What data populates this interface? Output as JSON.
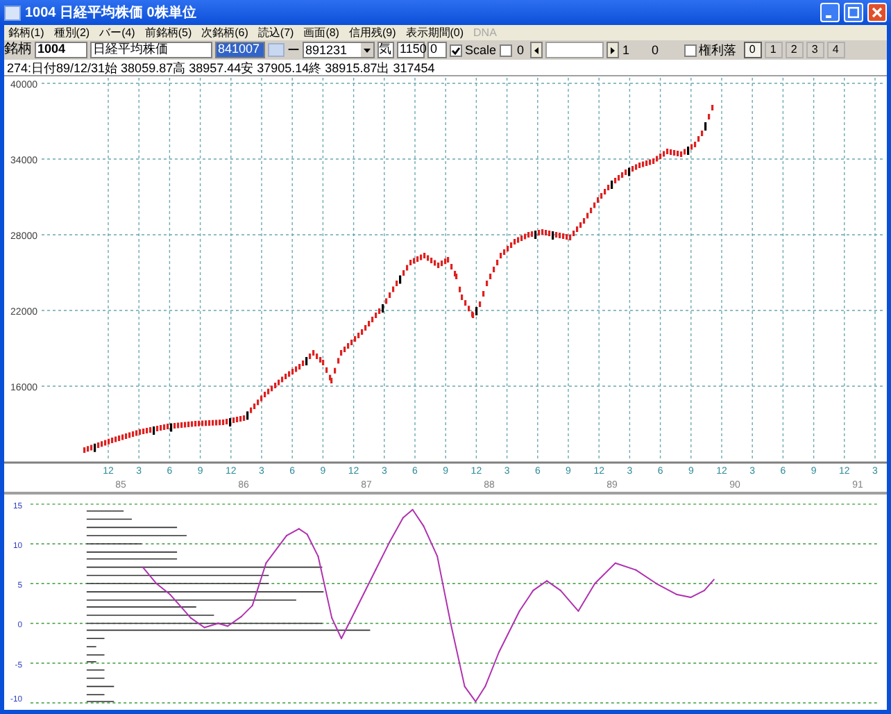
{
  "window": {
    "title": "1004 日経平均株価 0株単位"
  },
  "menu": [
    {
      "label": "銘柄(1)",
      "disabled": false
    },
    {
      "label": "種別(2)",
      "disabled": false
    },
    {
      "label": "バー(4)",
      "disabled": false
    },
    {
      "label": "前銘柄(5)",
      "disabled": false
    },
    {
      "label": "次銘柄(6)",
      "disabled": false
    },
    {
      "label": "読込(7)",
      "disabled": false
    },
    {
      "label": "画面(8)",
      "disabled": false
    },
    {
      "label": "信用残(9)",
      "disabled": false
    },
    {
      "label": "表示期間(0)",
      "disabled": false
    },
    {
      "label": "DNA",
      "disabled": true
    }
  ],
  "toolbar": {
    "symbol_label": "銘柄",
    "code": "1004",
    "name": "日経平均株価",
    "start_date": "841007",
    "separator": "ー",
    "end_date": "891231",
    "period": "気",
    "value_1": "1150",
    "value_2": "0",
    "scale_checkbox": {
      "label": "Scale",
      "checked": true
    },
    "checkbox_2": {
      "checked": false
    },
    "value_3": "0",
    "scroll_value_1": "1",
    "scroll_value_2": "0",
    "rights_checkbox": {
      "label": "権利落",
      "checked": false
    },
    "pane_buttons": [
      {
        "label": "0",
        "selected": true
      },
      {
        "label": "1",
        "selected": false
      },
      {
        "label": "2",
        "selected": false
      },
      {
        "label": "3",
        "selected": false
      },
      {
        "label": "4",
        "selected": false
      }
    ]
  },
  "info_line": "274:日付89/12/31始 38059.87高 38957.44安 37905.14終 38915.87出 317454",
  "price_chart": {
    "y_labels": [
      "40000",
      "34000",
      "28000",
      "22000",
      "16000"
    ],
    "month_labels": [
      "12",
      "3",
      "6",
      "9",
      "12",
      "3",
      "6",
      "9",
      "12",
      "3",
      "6",
      "9",
      "12",
      "3",
      "6",
      "9",
      "12",
      "3",
      "6",
      "9",
      "12",
      "3",
      "6",
      "9",
      "12",
      "3"
    ],
    "year_labels": [
      "85",
      "86",
      "87",
      "88",
      "89",
      "90",
      "91"
    ]
  },
  "oscillator": {
    "y_labels": [
      "15",
      "10",
      "5",
      "0",
      "-5",
      "-10"
    ]
  }
}
